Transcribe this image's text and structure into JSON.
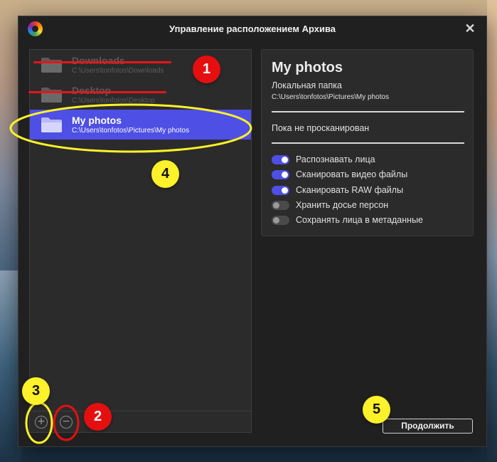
{
  "window": {
    "title": "Управление расположением Архива",
    "close_glyph": "✕"
  },
  "folders": [
    {
      "name": "Downloads",
      "path": "C:\\Users\\tonfotos\\Downloads",
      "state": "struck-out"
    },
    {
      "name": "Desktop",
      "path": "C:\\Users\\tonfotos\\Desktop",
      "state": "struck-out"
    },
    {
      "name": "My photos",
      "path": "C:\\Users\\tonfotos\\Pictures\\My photos",
      "state": "selected"
    }
  ],
  "list_actions": {
    "add_glyph": "+",
    "remove_glyph": "−"
  },
  "details": {
    "title": "My photos",
    "type": "Локальная папка",
    "path": "C:\\Users\\tonfotos\\Pictures\\My photos",
    "status": "Пока не просканирован",
    "toggles": [
      {
        "label": "Распознавать лица",
        "on": true
      },
      {
        "label": "Сканировать видео файлы",
        "on": true
      },
      {
        "label": "Сканировать RAW файлы",
        "on": true
      },
      {
        "label": "Хранить досье персон",
        "on": false
      },
      {
        "label": "Сохранять лица в метаданные",
        "on": false
      }
    ]
  },
  "continue_label": "Продолжить",
  "annotations": {
    "badge_1": "1",
    "badge_2": "2",
    "badge_3": "3",
    "badge_4": "4",
    "badge_5": "5"
  },
  "colors": {
    "accent": "#4e4fe4",
    "annotation_red": "#e50f10",
    "annotation_yellow": "#fff22a"
  },
  "icons": {
    "app": "app-logo-icon",
    "folder": "folder-icon",
    "close": "close-icon",
    "add": "add-circle-icon",
    "remove": "remove-circle-icon"
  }
}
